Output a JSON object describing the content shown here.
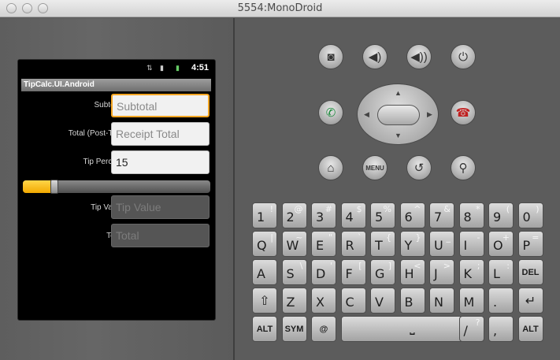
{
  "window": {
    "title": "5554:MonoDroid"
  },
  "status_bar": {
    "time": "4:51"
  },
  "app": {
    "title": "TipCalc.UI.Android",
    "subtotal": {
      "label": "Subtotal:",
      "placeholder": "Subtotal"
    },
    "total_post_tax": {
      "label": "Total (Post-Tax):",
      "placeholder": "Receipt Total"
    },
    "tip_percent": {
      "label": "Tip Percent:",
      "value": "15"
    },
    "tip_slider": {
      "value": 0.17
    },
    "tip_value": {
      "label": "Tip Value:",
      "placeholder": "Tip Value"
    },
    "total": {
      "label": "Total:",
      "placeholder": "Total"
    }
  },
  "hardware_buttons": {
    "row1": [
      "camera-icon",
      "volume-down-icon",
      "volume-up-icon",
      "power-icon"
    ],
    "call": "phone-call-icon",
    "end_call": "phone-end-icon",
    "row3": [
      "home-icon",
      "MENU",
      "back-icon",
      "search-icon"
    ]
  },
  "keyboard": {
    "row1": [
      {
        "main": "1",
        "alt": "!"
      },
      {
        "main": "2",
        "alt": "@"
      },
      {
        "main": "3",
        "alt": "#"
      },
      {
        "main": "4",
        "alt": "$"
      },
      {
        "main": "5",
        "alt": "%"
      },
      {
        "main": "6",
        "alt": "^"
      },
      {
        "main": "7",
        "alt": "&"
      },
      {
        "main": "8",
        "alt": "*"
      },
      {
        "main": "9",
        "alt": "("
      },
      {
        "main": "0",
        "alt": ")"
      }
    ],
    "row2": [
      {
        "main": "Q",
        "alt": "|"
      },
      {
        "main": "W",
        "alt": "~"
      },
      {
        "main": "E",
        "alt": "\""
      },
      {
        "main": "R",
        "alt": "`"
      },
      {
        "main": "T",
        "alt": "{"
      },
      {
        "main": "Y",
        "alt": "}"
      },
      {
        "main": "U",
        "alt": "_"
      },
      {
        "main": "I",
        "alt": "-"
      },
      {
        "main": "O",
        "alt": "+"
      },
      {
        "main": "P",
        "alt": "="
      }
    ],
    "row3": [
      {
        "main": "A",
        "alt": ""
      },
      {
        "main": "S",
        "alt": "\\"
      },
      {
        "main": "D",
        "alt": "'"
      },
      {
        "main": "F",
        "alt": "["
      },
      {
        "main": "G",
        "alt": "]"
      },
      {
        "main": "H",
        "alt": "<"
      },
      {
        "main": "J",
        "alt": ">"
      },
      {
        "main": "K",
        "alt": ";"
      },
      {
        "main": "L",
        "alt": ":"
      }
    ],
    "del": "DEL",
    "row4": [
      {
        "main": "Z",
        "alt": ""
      },
      {
        "main": "X",
        "alt": ""
      },
      {
        "main": "C",
        "alt": ""
      },
      {
        "main": "V",
        "alt": ""
      },
      {
        "main": "B",
        "alt": ""
      },
      {
        "main": "N",
        "alt": ""
      },
      {
        "main": "M",
        "alt": ""
      },
      {
        "main": ".",
        "alt": ""
      }
    ],
    "alt_key": "ALT",
    "sym_key": "SYM",
    "at_key": "@",
    "slash_key": {
      "main": "/",
      "alt": "?"
    },
    "comma_key": {
      "main": ",",
      "alt": ""
    }
  }
}
